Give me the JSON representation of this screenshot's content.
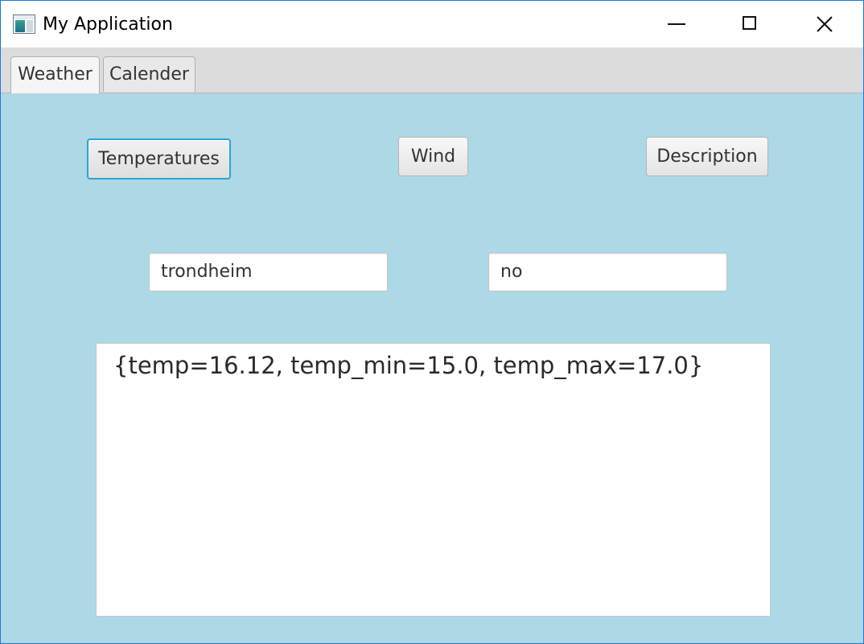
{
  "window": {
    "title": "My Application",
    "icon": "app-window-icon",
    "controls": [
      "minimize-icon",
      "maximize-icon",
      "close-icon"
    ]
  },
  "tabs": [
    {
      "label": "Weather",
      "selected": true
    },
    {
      "label": "Calender",
      "selected": false
    }
  ],
  "actions": {
    "temperatures_label": "Temperatures",
    "wind_label": "Wind",
    "description_label": "Description"
  },
  "inputs": {
    "city_value": "trondheim",
    "country_value": "no"
  },
  "output": {
    "text": "{temp=16.12, temp_min=15.0, temp_max=17.0}"
  },
  "colors": {
    "content_background": "#add8e6",
    "focus_accent": "#2aa6d6",
    "window_border": "#1e78d4"
  }
}
